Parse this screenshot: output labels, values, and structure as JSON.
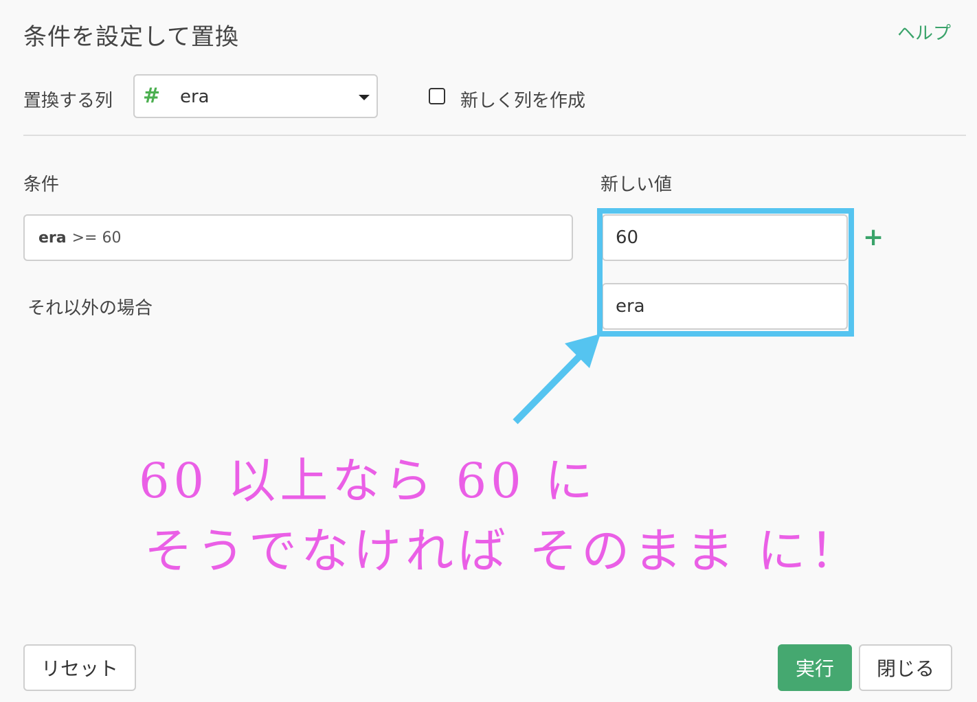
{
  "dialog": {
    "title": "条件を設定して置換",
    "help_label": "ヘルプ"
  },
  "column_row": {
    "label": "置換する列",
    "selected_column": "era",
    "type_icon": "hash-icon",
    "new_column_checkbox_label": "新しく列を作成",
    "new_column_checked": false
  },
  "rules": {
    "condition_header": "条件",
    "new_value_header": "新しい値",
    "condition_column": "era",
    "condition_expression": ">= 60",
    "new_value_1": "60",
    "else_label": "それ以外の場合",
    "else_value": "era"
  },
  "annotation": {
    "line1": "60 以上なら 60 に",
    "line2": "そうでなければ そのまま に！",
    "highlight_color": "#55c4f0",
    "text_color": "#ea5fe6"
  },
  "buttons": {
    "reset": "リセット",
    "run": "実行",
    "close": "閉じる"
  }
}
